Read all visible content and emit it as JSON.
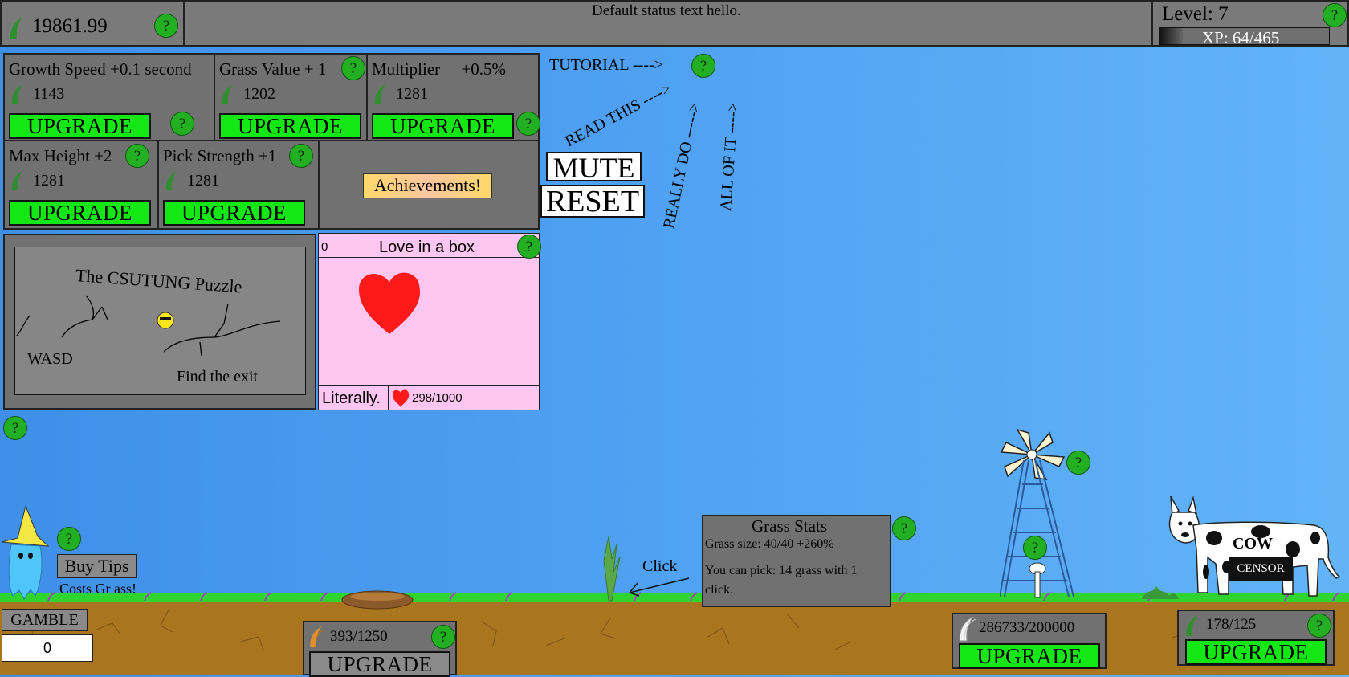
{
  "topbar": {
    "grass_total": "19861.99",
    "status_text": "Default status text hello.",
    "level_label": "Level: 7",
    "xp_label": "XP: 64/465",
    "xp_fraction": 0.1376
  },
  "upgrades": {
    "growth": {
      "title": "Growth Speed +0.1 second",
      "cost": "1143",
      "button": "UPGRADE"
    },
    "grass_value": {
      "title": "Grass Value + 1",
      "cost": "1202",
      "button": "UPGRADE"
    },
    "multiplier": {
      "title": "Multiplier     +0.5%",
      "cost": "1281",
      "button": "UPGRADE"
    },
    "max_height": {
      "title": "Max Height +2",
      "cost": "1281",
      "button": "UPGRADE"
    },
    "pick_strength": {
      "title": "Pick Strength +1",
      "cost": "1281",
      "button": "UPGRADE"
    }
  },
  "achievements_label": "Achievements!",
  "tutorial": {
    "tutorial": "TUTORIAL ---->",
    "read_this": "READ THIS ---->",
    "really_do": "REALLY DO ----->",
    "all_of_it": "ALL OF IT ---->"
  },
  "mute_label": "MUTE",
  "reset_label": "RESET",
  "puzzle": {
    "title": "The CSUTUNG Puzzle",
    "controls": "WASD",
    "goal": "Find the exit"
  },
  "love": {
    "count": "0",
    "title": "Love in a box",
    "caption": "Literally.",
    "progress": "298/1000"
  },
  "tips": {
    "button": "Buy Tips",
    "note": "Costs Gr ass!"
  },
  "gamble": {
    "label": "GAMBLE",
    "value": "0"
  },
  "click_label": "Click",
  "grass_stats": {
    "title": "Grass Stats",
    "size": "Grass size: 40/40 +260%",
    "pick": "You can pick: 14 grass with 1 click."
  },
  "shop_left": {
    "progress": "393/1250",
    "button": "UPGRADE"
  },
  "shop_mid": {
    "progress": "286733/200000",
    "button": "UPGRADE"
  },
  "shop_right": {
    "progress": "178/125",
    "button": "UPGRADE"
  },
  "cow": {
    "label": "COW",
    "censor": "CENSOR"
  },
  "help_symbol": "?",
  "colors": {
    "accent_green": "#14e814",
    "panel_gray": "#717171",
    "love_pink": "#ffc6f2",
    "heart_red": "#ff1a1a"
  }
}
